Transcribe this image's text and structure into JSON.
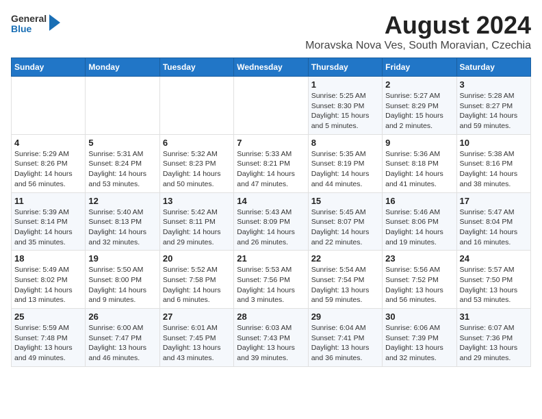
{
  "header": {
    "logo_general": "General",
    "logo_blue": "Blue",
    "main_title": "August 2024",
    "sub_title": "Moravska Nova Ves, South Moravian, Czechia"
  },
  "calendar": {
    "days_of_week": [
      "Sunday",
      "Monday",
      "Tuesday",
      "Wednesday",
      "Thursday",
      "Friday",
      "Saturday"
    ],
    "weeks": [
      [
        {
          "day": "",
          "info": ""
        },
        {
          "day": "",
          "info": ""
        },
        {
          "day": "",
          "info": ""
        },
        {
          "day": "",
          "info": ""
        },
        {
          "day": "1",
          "info": "Sunrise: 5:25 AM\nSunset: 8:30 PM\nDaylight: 15 hours\nand 5 minutes."
        },
        {
          "day": "2",
          "info": "Sunrise: 5:27 AM\nSunset: 8:29 PM\nDaylight: 15 hours\nand 2 minutes."
        },
        {
          "day": "3",
          "info": "Sunrise: 5:28 AM\nSunset: 8:27 PM\nDaylight: 14 hours\nand 59 minutes."
        }
      ],
      [
        {
          "day": "4",
          "info": "Sunrise: 5:29 AM\nSunset: 8:26 PM\nDaylight: 14 hours\nand 56 minutes."
        },
        {
          "day": "5",
          "info": "Sunrise: 5:31 AM\nSunset: 8:24 PM\nDaylight: 14 hours\nand 53 minutes."
        },
        {
          "day": "6",
          "info": "Sunrise: 5:32 AM\nSunset: 8:23 PM\nDaylight: 14 hours\nand 50 minutes."
        },
        {
          "day": "7",
          "info": "Sunrise: 5:33 AM\nSunset: 8:21 PM\nDaylight: 14 hours\nand 47 minutes."
        },
        {
          "day": "8",
          "info": "Sunrise: 5:35 AM\nSunset: 8:19 PM\nDaylight: 14 hours\nand 44 minutes."
        },
        {
          "day": "9",
          "info": "Sunrise: 5:36 AM\nSunset: 8:18 PM\nDaylight: 14 hours\nand 41 minutes."
        },
        {
          "day": "10",
          "info": "Sunrise: 5:38 AM\nSunset: 8:16 PM\nDaylight: 14 hours\nand 38 minutes."
        }
      ],
      [
        {
          "day": "11",
          "info": "Sunrise: 5:39 AM\nSunset: 8:14 PM\nDaylight: 14 hours\nand 35 minutes."
        },
        {
          "day": "12",
          "info": "Sunrise: 5:40 AM\nSunset: 8:13 PM\nDaylight: 14 hours\nand 32 minutes."
        },
        {
          "day": "13",
          "info": "Sunrise: 5:42 AM\nSunset: 8:11 PM\nDaylight: 14 hours\nand 29 minutes."
        },
        {
          "day": "14",
          "info": "Sunrise: 5:43 AM\nSunset: 8:09 PM\nDaylight: 14 hours\nand 26 minutes."
        },
        {
          "day": "15",
          "info": "Sunrise: 5:45 AM\nSunset: 8:07 PM\nDaylight: 14 hours\nand 22 minutes."
        },
        {
          "day": "16",
          "info": "Sunrise: 5:46 AM\nSunset: 8:06 PM\nDaylight: 14 hours\nand 19 minutes."
        },
        {
          "day": "17",
          "info": "Sunrise: 5:47 AM\nSunset: 8:04 PM\nDaylight: 14 hours\nand 16 minutes."
        }
      ],
      [
        {
          "day": "18",
          "info": "Sunrise: 5:49 AM\nSunset: 8:02 PM\nDaylight: 14 hours\nand 13 minutes."
        },
        {
          "day": "19",
          "info": "Sunrise: 5:50 AM\nSunset: 8:00 PM\nDaylight: 14 hours\nand 9 minutes."
        },
        {
          "day": "20",
          "info": "Sunrise: 5:52 AM\nSunset: 7:58 PM\nDaylight: 14 hours\nand 6 minutes."
        },
        {
          "day": "21",
          "info": "Sunrise: 5:53 AM\nSunset: 7:56 PM\nDaylight: 14 hours\nand 3 minutes."
        },
        {
          "day": "22",
          "info": "Sunrise: 5:54 AM\nSunset: 7:54 PM\nDaylight: 13 hours\nand 59 minutes."
        },
        {
          "day": "23",
          "info": "Sunrise: 5:56 AM\nSunset: 7:52 PM\nDaylight: 13 hours\nand 56 minutes."
        },
        {
          "day": "24",
          "info": "Sunrise: 5:57 AM\nSunset: 7:50 PM\nDaylight: 13 hours\nand 53 minutes."
        }
      ],
      [
        {
          "day": "25",
          "info": "Sunrise: 5:59 AM\nSunset: 7:48 PM\nDaylight: 13 hours\nand 49 minutes."
        },
        {
          "day": "26",
          "info": "Sunrise: 6:00 AM\nSunset: 7:47 PM\nDaylight: 13 hours\nand 46 minutes."
        },
        {
          "day": "27",
          "info": "Sunrise: 6:01 AM\nSunset: 7:45 PM\nDaylight: 13 hours\nand 43 minutes."
        },
        {
          "day": "28",
          "info": "Sunrise: 6:03 AM\nSunset: 7:43 PM\nDaylight: 13 hours\nand 39 minutes."
        },
        {
          "day": "29",
          "info": "Sunrise: 6:04 AM\nSunset: 7:41 PM\nDaylight: 13 hours\nand 36 minutes."
        },
        {
          "day": "30",
          "info": "Sunrise: 6:06 AM\nSunset: 7:39 PM\nDaylight: 13 hours\nand 32 minutes."
        },
        {
          "day": "31",
          "info": "Sunrise: 6:07 AM\nSunset: 7:36 PM\nDaylight: 13 hours\nand 29 minutes."
        }
      ]
    ]
  }
}
